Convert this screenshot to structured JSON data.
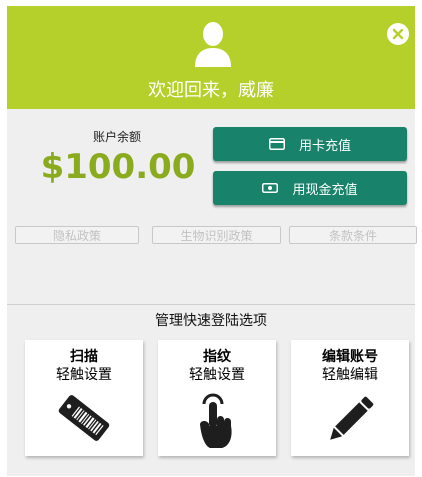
{
  "header": {
    "welcome_text": "欢迎回来，威廉",
    "bg_color": "#b5cf2b",
    "avatar_icon": "user-avatar-icon",
    "close_icon": "close-circle-icon"
  },
  "balance": {
    "label": "账户余额",
    "amount": "$100.00",
    "amount_color": "#8bab1e"
  },
  "reload_buttons": [
    {
      "label": "用卡充值",
      "icon": "credit-card-icon"
    },
    {
      "label": "用现金充值",
      "icon": "cash-icon"
    }
  ],
  "button_color": "#19826a",
  "policy_links": [
    {
      "label": "隐私政策"
    },
    {
      "label": "生物识别政策"
    },
    {
      "label": "条款条件"
    }
  ],
  "quick_login": {
    "title": "管理快速登陆选项",
    "tiles": [
      {
        "title": "扫描",
        "subtitle": "轻触设置",
        "icon": "barcode-card-icon"
      },
      {
        "title": "指纹",
        "subtitle": "轻触设置",
        "icon": "tap-finger-icon"
      },
      {
        "title": "编辑账号",
        "subtitle": "轻触编辑",
        "icon": "pencil-icon"
      }
    ]
  }
}
